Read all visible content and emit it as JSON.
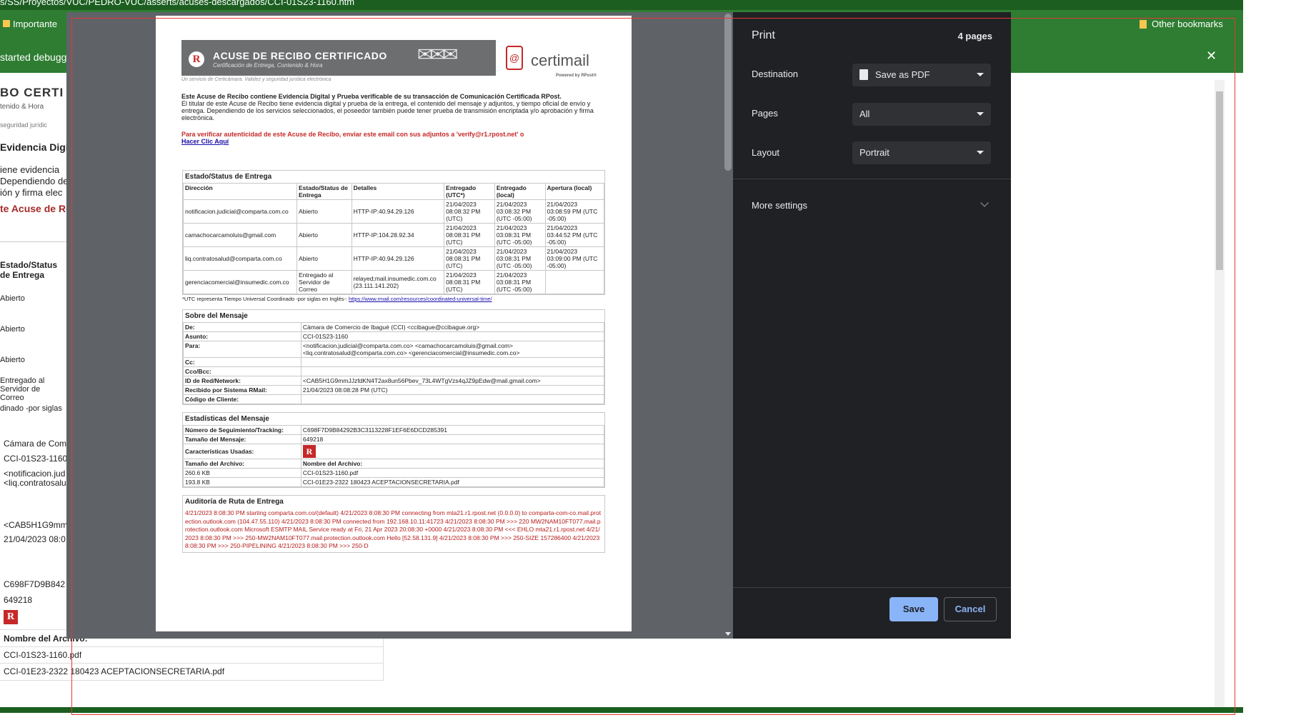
{
  "browser": {
    "address": "s/SS/Proyectos/VUC/PEDRO-VUC/asserts/acuses-descargados/CCI-01S23-1160.htm",
    "bookmark_important": "Importante",
    "bookmark_other": "Other bookmarks",
    "info_text": "started debugg"
  },
  "background": {
    "header_title": "BO CERTI",
    "header_sub": "tenido & Hora",
    "header_sub2": "seguridad jurídic",
    "evidencia": "Evidencia Digit",
    "lines": [
      "iene evidencia",
      "Dependiendo de",
      "ión y firma elec"
    ],
    "acuse_red": "te Acuse de Re",
    "status_header": [
      "Estado/Status",
      "de Entrega"
    ],
    "status_rows": [
      "Abierto",
      "Abierto",
      "Abierto"
    ],
    "entregado": [
      "Entregado al",
      "Servidor de",
      "Correo"
    ],
    "utc_note": "dinado -por siglas",
    "msg_cells": [
      "Cámara de Com",
      "CCI-01S23-1160",
      "<notificacion.jud",
      "<liq.contratosalu",
      "<CAB5H1G9mm",
      "21/04/2023 08:0"
    ],
    "stats_cells": [
      "C698F7D9B842",
      "649218"
    ],
    "file_header": "Nombre del Archivo:",
    "files": [
      "CCI-01S23-1160.pdf",
      "CCI-01E23-2322 180423 ACEPTACIONSECRETARIA.pdf"
    ]
  },
  "print_panel": {
    "title": "Print",
    "pages_count": "4 pages",
    "destination_label": "Destination",
    "destination_value": "Save as PDF",
    "pages_label": "Pages",
    "pages_value": "All",
    "layout_label": "Layout",
    "layout_value": "Portrait",
    "more_settings": "More settings",
    "save": "Save",
    "cancel": "Cancel",
    "accent": "#8ab4f8"
  },
  "doc": {
    "banner_title": "ACUSE DE RECIBO CERTIFICADO",
    "banner_sub": "Certificación de Entrega, Contenido & Hora",
    "banner_tagline": "Un servicio de Certicámara. Validez y seguridad jurídica electrónica",
    "brand": "certimail",
    "powered": "Powered by RPost®",
    "intro_bold": "Este Acuse de Recibo contiene Evidencia Digital y Prueba verificable de su transacción de Comunicación Certificada RPost.",
    "intro_text": "El titular de este Acuse de Recibo tiene evidencia digital y prueba de la entrega, el contenido del mensaje y adjuntos, y tiempo oficial de envío y entrega. Dependiendo de los servicios seleccionados, el poseedor también puede tener prueba de transmisión encriptada y/o aprobación y firma electrónica.",
    "verify_text": "Para verificar autenticidad de este Acuse de Recibo, enviar este email con sus adjuntos a 'verify@r1.rpost.net' o",
    "verify_link": "Hacer Clic Aquí",
    "status_title": "Estado/Status de Entrega",
    "status_cols": [
      "Dirección",
      "Estado/Status de Entrega",
      "Detalles",
      "Entregado (UTC*)",
      "Entregado (local)",
      "Apertura (local)"
    ],
    "status_rows": [
      [
        "notificacion.judicial@comparta.com.co",
        "Abierto",
        "HTTP-IP:40.94.29.126",
        "21/04/2023 08:08:32 PM (UTC)",
        "21/04/2023 03:08:32 PM (UTC -05:00)",
        "21/04/2023 03:08:59 PM (UTC -05:00)"
      ],
      [
        "camachocarcamoluis@gmail.com",
        "Abierto",
        "HTTP-IP:104.28.92.34",
        "21/04/2023 08:08:31 PM (UTC)",
        "21/04/2023 03:08:31 PM (UTC -05:00)",
        "21/04/2023 03:44:52 PM (UTC -05:00)"
      ],
      [
        "liq.contratosalud@comparta.com.co",
        "Abierto",
        "HTTP-IP:40.94.29.126",
        "21/04/2023 08:08:31 PM (UTC)",
        "21/04/2023 03:08:31 PM (UTC -05:00)",
        "21/04/2023 03:09:00 PM (UTC -05:00)"
      ],
      [
        "gerenciacomercial@insumedic.com.co",
        "Entregado al Servidor de Correo",
        "relayed;mail.insumedic.com.co (23.111.141.202)",
        "21/04/2023 08:08:31 PM (UTC)",
        "21/04/2023 03:08:31 PM (UTC -05:00)",
        ""
      ]
    ],
    "utc_note": "*UTC representa Tiempo Universal Coordinado -por siglas en Inglés-:",
    "utc_link": "https://www.rmail.com/resources/coordinated-universal-time/",
    "msg_title": "Sobre del Mensaje",
    "msg_rows": [
      [
        "De:",
        "Cámara de Comercio de Ibagué (CCI) <ccibague@ccibague.org>"
      ],
      [
        "Asunto:",
        "CCI-01S23-1160"
      ],
      [
        "Para:",
        "<notificacion.judicial@comparta.com.co> <camachocarcamoluis@gmail.com> <liq.contratosalud@comparta.com.co> <gerenciacomercial@insumedic.com.co>"
      ],
      [
        "Cc:",
        ""
      ],
      [
        "Cco/Bcc:",
        ""
      ],
      [
        "ID de Red/Network:",
        "<CAB5H1G9mmJJzfdKN4T2ax8un56Pbev_73L4WTgVzs4qJZ9pEdw@mail.gmail.com>"
      ],
      [
        "Recibido por Sistema RMail:",
        "21/04/2023 08:08:28 PM (UTC)"
      ],
      [
        "Código de Cliente:",
        ""
      ]
    ],
    "stats_title": "Estadísticas del Mensaje",
    "stats_rows": [
      [
        "Número de Seguimiento/Tracking:",
        "C698F7D9B84292B3C3113228F1EF6E6DCD285391"
      ],
      [
        "Tamaño del Mensaje:",
        "649218"
      ],
      [
        "Características Usadas:",
        "R"
      ]
    ],
    "file_cols": [
      "Tamaño del Archivo:",
      "Nombre del Archivo:"
    ],
    "files": [
      [
        "260.6 KB",
        "CCI-01S23-1160.pdf"
      ],
      [
        "193.8 KB",
        "CCI-01E23-2322 180423 ACEPTACIONSECRETARIA.pdf"
      ]
    ],
    "audit_title": "Auditoría de Ruta de Entrega",
    "audit_text": "4/21/2023 8:08:30 PM starting comparta.com.co/(default) 4/21/2023 8:08:30 PM connecting from mta21.r1.rpost.net (0.0.0.0) to comparta-com-co.mail.protection.outlook.com (104.47.55.110) 4/21/2023 8:08:30 PM connected from 192.168.10.11:41723 4/21/2023 8:08:30 PM >>> 220 MW2NAM10FT077.mail.protection.outlook.com Microsoft ESMTP MAIL Service ready at Fri, 21 Apr 2023 20:08:30 +0000 4/21/2023 8:08:30 PM <<< EHLO mta21.r1.rpost.net 4/21/2023 8:08:30 PM >>> 250-MW2NAM10FT077.mail.protection.outlook.com Hello [52.58.131.9] 4/21/2023 8:08:30 PM >>> 250-SIZE 157286400 4/21/2023 8:08:30 PM >>> 250-PIPELINING 4/21/2023 8:08:30 PM >>> 250-D"
  }
}
